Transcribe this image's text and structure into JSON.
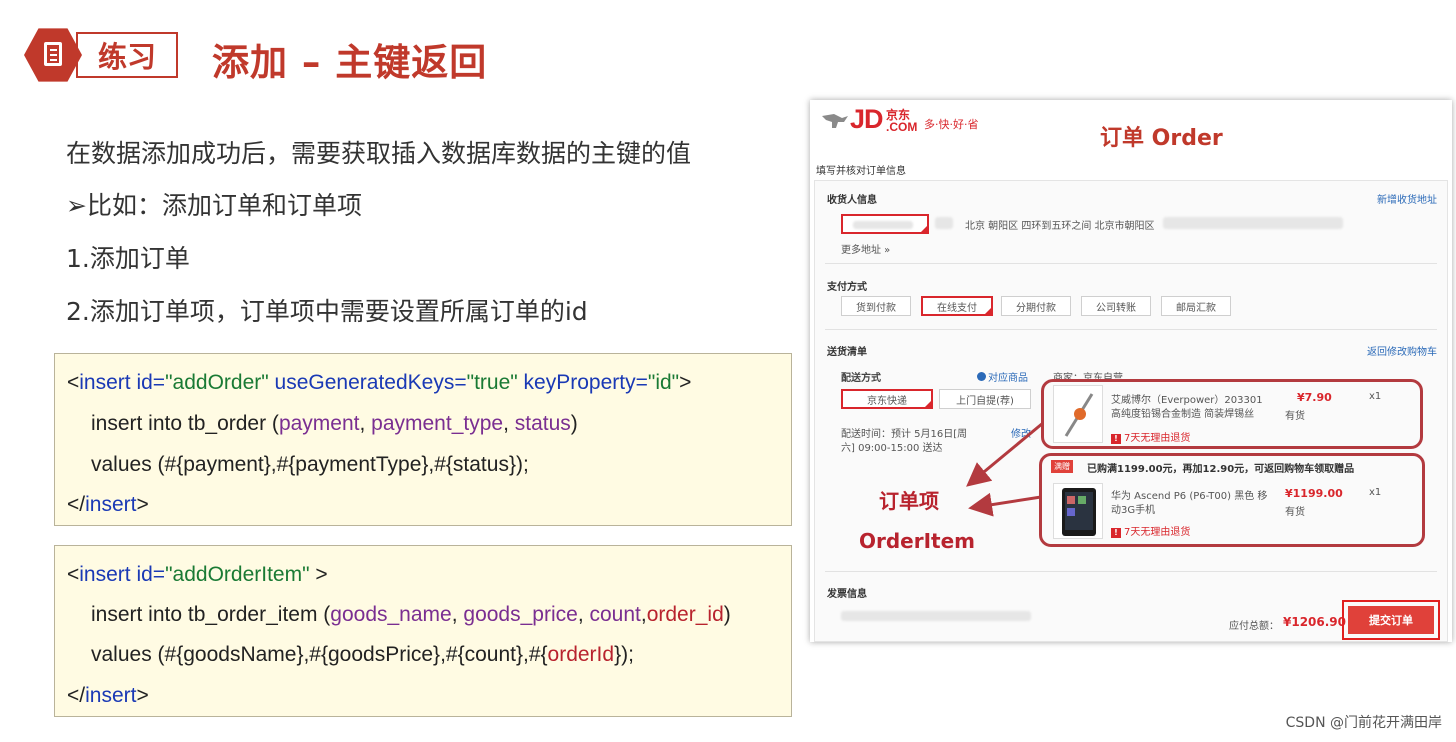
{
  "header": {
    "tag": "练习",
    "title": "添加 – 主键返回"
  },
  "bullets": [
    "在数据添加成功后，需要获取插入数据库数据的主键的值",
    "➢比如：添加订单和订单项",
    "1.添加订单",
    "2.添加订单项，订单项中需要设置所属订单的id"
  ],
  "code1": {
    "l1": {
      "open": "<",
      "tag": "insert",
      "a1": " id=",
      "v1": "\"addOrder\"",
      "a2": " useGeneratedKeys=",
      "v2": "\"true\"",
      "a3": " keyProperty=",
      "v3": "\"id\"",
      "close": ">"
    },
    "l2": {
      "pre": "insert into tb_order (",
      "c1": "payment",
      "s1": ", ",
      "c2": "payment_type",
      "s2": ", ",
      "c3": "status",
      "post": ")"
    },
    "l3": "values (#{payment},#{paymentType},#{status});",
    "l4": {
      "open": "</",
      "tag": "insert",
      "close": ">"
    }
  },
  "code2": {
    "l1": {
      "open": "<",
      "tag": "insert",
      "a1": " id=",
      "v1": "\"addOrderItem\"",
      "close": " >"
    },
    "l2": {
      "pre": "insert into tb_order_item (",
      "c1": "goods_name",
      "s1": ", ",
      "c2": "goods_price",
      "s2": ", ",
      "c3": "count",
      "s3": ",",
      "c4": "order_id",
      "post": ")"
    },
    "l3": {
      "pre": "values (#{goodsName},#{goodsPrice},#{count},#{",
      "c1": "orderId",
      "post": "});"
    },
    "l4": {
      "open": "</",
      "tag": "insert",
      "close": ">"
    }
  },
  "jd": {
    "logo": "JD",
    "logo_cn": "京东",
    "logo_com": ".COM",
    "slogan": "多·快·好·省",
    "order_title": "订单 Order",
    "fill_info": "填写并核对订单信息",
    "receiver_title": "收货人信息",
    "new_address": "新增收货地址",
    "address": "北京 朝阳区 四环到五环之间 北京市朝阳区",
    "more_address": "更多地址 »",
    "pay_title": "支付方式",
    "pay_options": [
      "货到付款",
      "在线支付",
      "分期付款",
      "公司转账",
      "邮局汇款"
    ],
    "ship_title": "送货清单",
    "back_to_cart": "返回修改购物车",
    "delivery_mode": "配送方式",
    "match_item": "对应商品",
    "merchant": "商家：京东自营",
    "ship_options": [
      "京东快递",
      "上门自提(荐)"
    ],
    "delivery_time_1": "配送时间：预计 5月16日[周",
    "delivery_time_2": "六] 09:00-15:00 送达",
    "edit": "修改",
    "item1_name_1": "艾威博尔（Everpower）203301",
    "item1_name_2": "高纯度铅锡合金制造 简装焊锡丝",
    "item1_price": "¥7.90",
    "item1_qty": "x1",
    "item1_stock": "有货",
    "return_policy": "7天无理由退货",
    "promo_tag": "满赠",
    "promo_text": "已购满1199.00元，再加12.90元，可返回购物车领取赠品",
    "item2_name_1": "华为 Ascend P6 (P6-T00) 黑色 移",
    "item2_name_2": "动3G手机",
    "item2_price": "¥1199.00",
    "item2_qty": "x1",
    "item2_stock": "有货",
    "annot_cn": "订单项",
    "annot_en": "OrderItem",
    "invoice_title": "发票信息",
    "payable_label": "应付总额：",
    "payable_value": "¥1206.90",
    "submit": "提交订单"
  },
  "watermark": "CSDN @门前花开满田岸"
}
